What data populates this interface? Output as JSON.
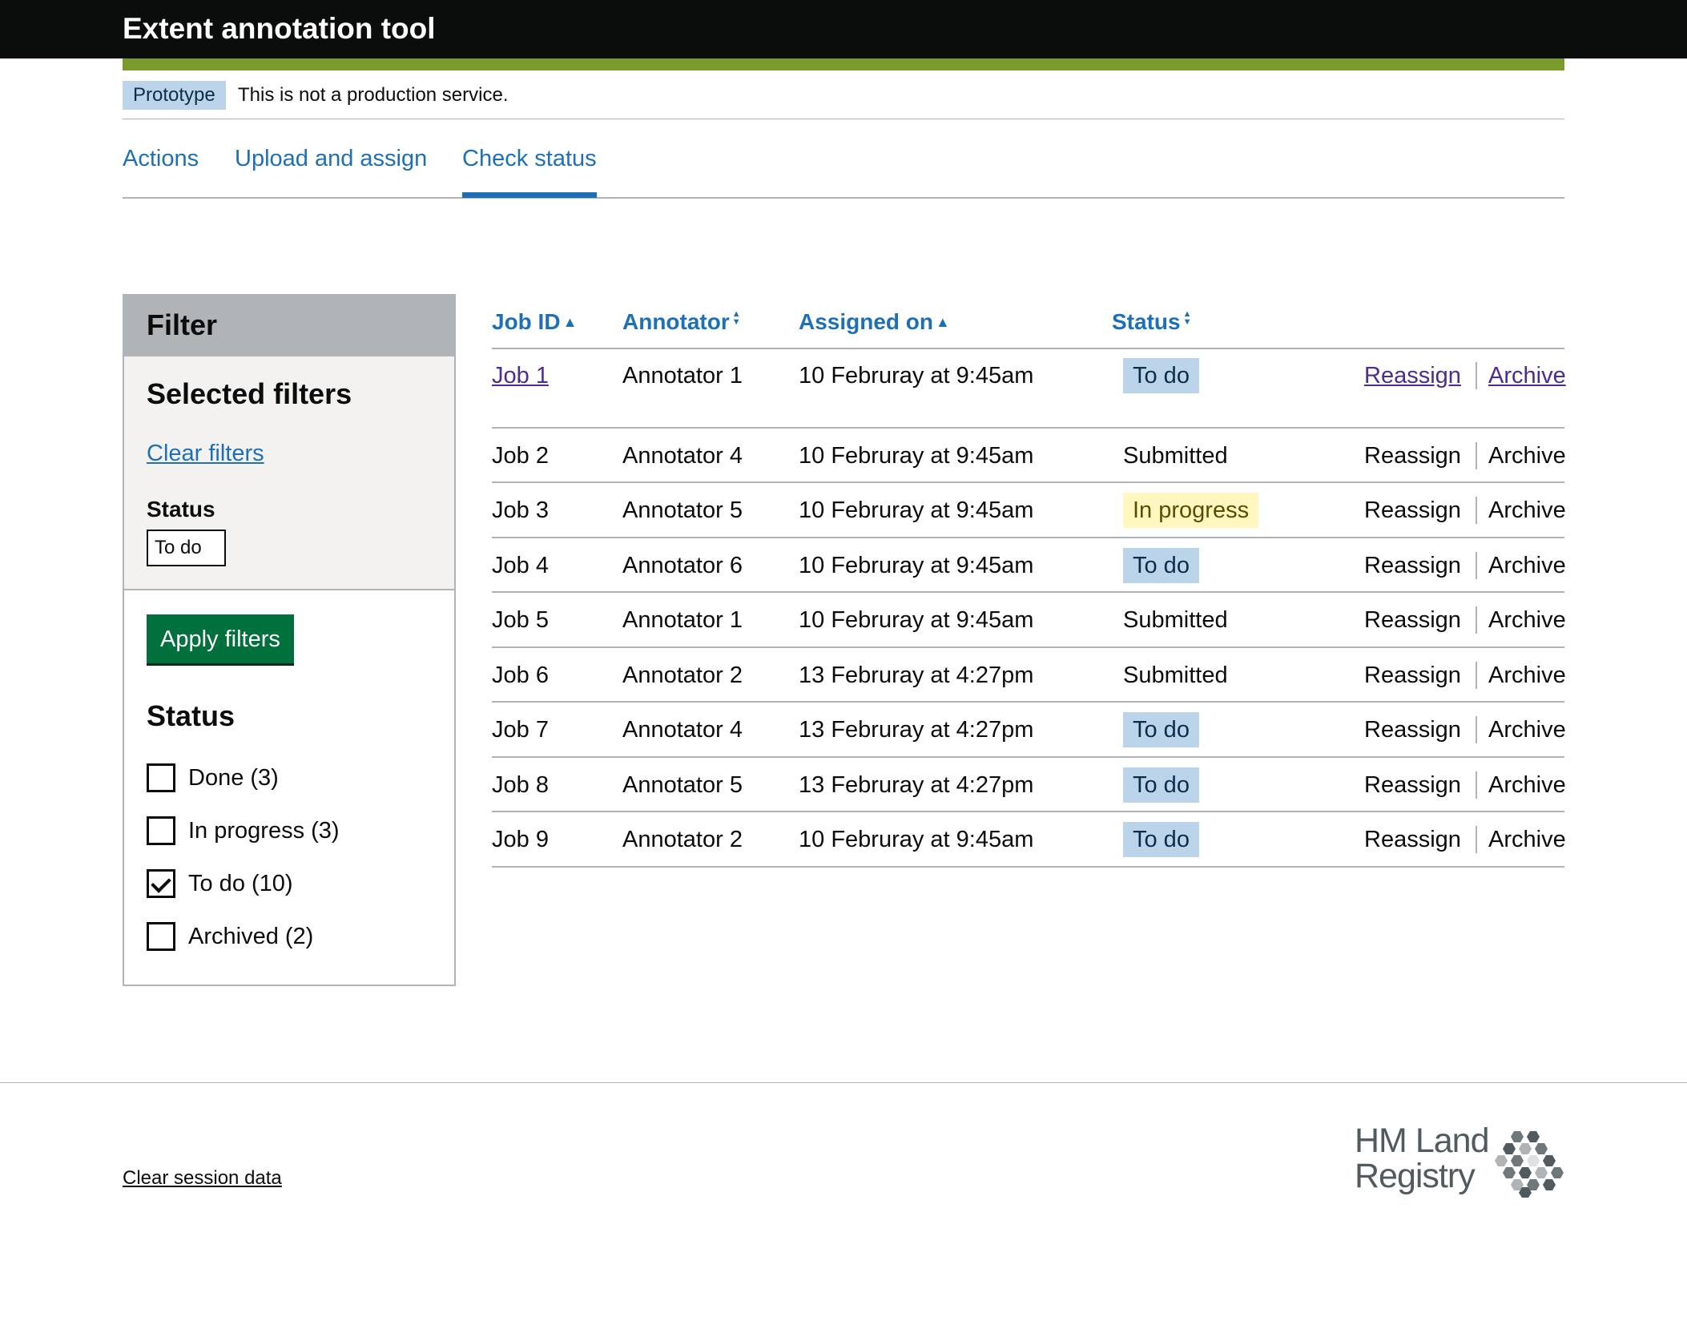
{
  "header": {
    "title": "Extent annotation tool"
  },
  "phase": {
    "tag": "Prototype",
    "text": "This is not a production service."
  },
  "tabs": [
    {
      "label": "Actions"
    },
    {
      "label": "Upload and assign"
    },
    {
      "label": "Check status",
      "active": true
    }
  ],
  "filter": {
    "title": "Filter",
    "selected_heading": "Selected filters",
    "clear_link": "Clear filters",
    "selected_status_label": "Status",
    "selected_tag": "To do",
    "apply_button": "Apply filters",
    "status_heading": "Status",
    "options": [
      {
        "label": "Done (3)",
        "checked": false
      },
      {
        "label": "In progress (3)",
        "checked": false
      },
      {
        "label": "To do (10)",
        "checked": true
      },
      {
        "label": "Archived (2)",
        "checked": false
      }
    ]
  },
  "table": {
    "headers": {
      "job_id": "Job ID",
      "annotator": "Annotator",
      "assigned_on": "Assigned on",
      "status": "Status"
    },
    "rows": [
      {
        "job": "Job 1",
        "annotator": "Annotator 1",
        "assigned": "10 Februray at 9:45am",
        "status": "To do",
        "reassign": "Reassign",
        "archive": "Archive"
      },
      {
        "job": "Job 2",
        "annotator": "Annotator 4",
        "assigned": "10 Februray at 9:45am",
        "status": "Submitted",
        "reassign": "Reassign",
        "archive": "Archive"
      },
      {
        "job": "Job 3",
        "annotator": "Annotator 5",
        "assigned": "10 Februray at 9:45am",
        "status": "In progress",
        "reassign": "Reassign",
        "archive": "Archive"
      },
      {
        "job": "Job 4",
        "annotator": "Annotator 6",
        "assigned": "10 Februray at 9:45am",
        "status": "To do",
        "reassign": "Reassign",
        "archive": "Archive"
      },
      {
        "job": "Job 5",
        "annotator": "Annotator 1",
        "assigned": "10 Februray at 9:45am",
        "status": "Submitted",
        "reassign": "Reassign",
        "archive": "Archive"
      },
      {
        "job": "Job 6",
        "annotator": "Annotator 2",
        "assigned": "13 Februray at 4:27pm",
        "status": "Submitted",
        "reassign": "Reassign",
        "archive": "Archive"
      },
      {
        "job": "Job 7",
        "annotator": "Annotator 4",
        "assigned": "13 Februray at 4:27pm",
        "status": "To do",
        "reassign": "Reassign",
        "archive": "Archive"
      },
      {
        "job": "Job 8",
        "annotator": "Annotator 5",
        "assigned": "13 Februray at 4:27pm",
        "status": "To do",
        "reassign": "Reassign",
        "archive": "Archive"
      },
      {
        "job": "Job 9",
        "annotator": "Annotator 2",
        "assigned": "10 Februray at 9:45am",
        "status": "To do",
        "reassign": "Reassign",
        "archive": "Archive"
      }
    ]
  },
  "footer": {
    "clear_session": "Clear session data",
    "logo_line1": "HM Land",
    "logo_line2": "Registry"
  },
  "colors": {
    "link": "#1d70b8",
    "visited": "#4c2c92",
    "accent_bar": "#7a9a2c",
    "button": "#00703c",
    "todo_tag": "#bbd4ea",
    "progress_tag": "#fff7bf"
  },
  "icons": {
    "sort_up": "triangle-up-icon",
    "sort_both": "sort-icon",
    "logo": "hexagon-cluster-logo"
  }
}
